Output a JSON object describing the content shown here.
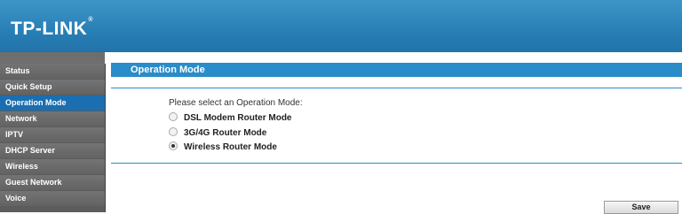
{
  "header": {
    "logo_text": "TP-LINK",
    "logo_mark": "®"
  },
  "sidebar": {
    "items": [
      {
        "label": "Status"
      },
      {
        "label": "Quick Setup"
      },
      {
        "label": "Operation Mode",
        "active": true
      },
      {
        "label": "Network"
      },
      {
        "label": "IPTV"
      },
      {
        "label": "DHCP Server"
      },
      {
        "label": "Wireless"
      },
      {
        "label": "Guest Network"
      },
      {
        "label": "Voice"
      }
    ]
  },
  "main": {
    "section_title": "Operation Mode",
    "prompt": "Please select an Operation Mode:",
    "options": [
      {
        "label": "DSL Modem Router Mode",
        "selected": false
      },
      {
        "label": "3G/4G Router Mode",
        "selected": false
      },
      {
        "label": "Wireless Router Mode",
        "selected": true
      }
    ],
    "save_label": "Save"
  },
  "colors": {
    "header_blue": "#2a81b7",
    "section_blue": "#2a8cc8",
    "active_item": "#1b6fb0",
    "sidebar_gray": "#6a6a6a"
  }
}
